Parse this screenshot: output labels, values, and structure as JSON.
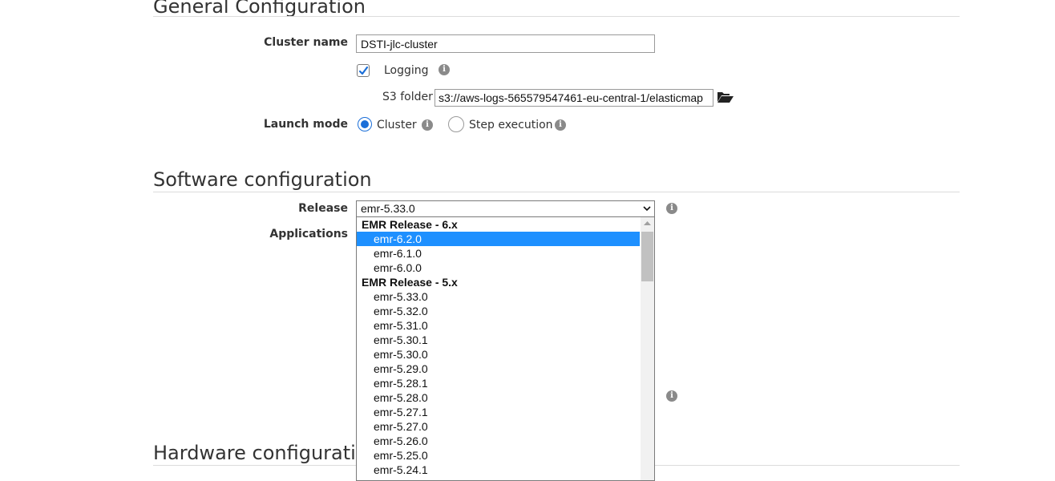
{
  "general": {
    "title": "General Configuration",
    "cluster_name_label": "Cluster name",
    "cluster_name_value": "DSTI-jlc-cluster",
    "logging_label": "Logging",
    "logging_checked": true,
    "s3_folder_label": "S3 folder",
    "s3_folder_value": "s3://aws-logs-565579547461-eu-central-1/elasticmap",
    "launch_mode_label": "Launch mode",
    "launch_mode_options": [
      "Cluster",
      "Step execution"
    ],
    "launch_mode_selected": "Cluster"
  },
  "software": {
    "title": "Software configuration",
    "release_label": "Release",
    "release_value": "emr-5.33.0",
    "applications_label": "Applications",
    "dropdown": {
      "groups": [
        {
          "label": "EMR Release - 6.x",
          "options": [
            "emr-6.2.0",
            "emr-6.1.0",
            "emr-6.0.0"
          ]
        },
        {
          "label": "EMR Release - 5.x",
          "options": [
            "emr-5.33.0",
            "emr-5.32.0",
            "emr-5.31.0",
            "emr-5.30.1",
            "emr-5.30.0",
            "emr-5.29.0",
            "emr-5.28.1",
            "emr-5.28.0",
            "emr-5.27.1",
            "emr-5.27.0",
            "emr-5.26.0",
            "emr-5.25.0",
            "emr-5.24.1"
          ]
        }
      ],
      "highlighted": "emr-6.2.0"
    }
  },
  "hardware": {
    "title": "Hardware configuration"
  },
  "icons": {
    "info": "info-icon",
    "folder": "folder-open-icon",
    "checkmark": "checkmark-icon",
    "chevron": "chevron-down-icon"
  },
  "colors": {
    "accent": "#1a6ed8",
    "highlight": "#1e90ff"
  }
}
